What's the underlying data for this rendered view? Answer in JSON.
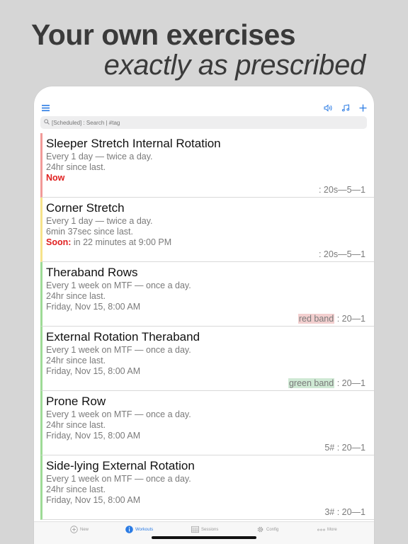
{
  "headline": "Your own exercises",
  "subline": "exactly as prescribed",
  "search": {
    "placeholder": "[Scheduled] : Search | #tag"
  },
  "colors": {
    "accent": "#2a7be4",
    "red": "#e02020",
    "now_bar": "#f19a98",
    "soon_bar": "#f6e38a",
    "ok_bar": "#9edb96"
  },
  "toolbar": {
    "icons": [
      "menu-icon",
      "speaker-icon",
      "music-note-icon",
      "plus-icon"
    ]
  },
  "exercises": [
    {
      "title": "Sleeper Stretch Internal Rotation",
      "schedule": "Every 1 day  — twice a day.",
      "since": "24hr since last.",
      "status": "Now",
      "tag": "",
      "sets": ": 20s—5—1"
    },
    {
      "title": "Corner Stretch",
      "schedule": "Every 1 day  — twice a day.",
      "since": "6min 37sec since last.",
      "soon_label": "Soon:",
      "soon_text": " in 22 minutes at 9:00 PM",
      "tag": "",
      "sets": ": 20s—5—1"
    },
    {
      "title": "Theraband Rows",
      "schedule": "Every 1 week on MTF — once a day.",
      "since": "24hr since last.",
      "next": "Friday, Nov 15, 8:00 AM",
      "tag": "red band",
      "sets": " : 20—1"
    },
    {
      "title": "External Rotation Theraband",
      "schedule": "Every 1 week on MTF — once a day.",
      "since": "24hr since last.",
      "next": "Friday, Nov 15, 8:00 AM",
      "tag": "green band",
      "sets": " : 20—1"
    },
    {
      "title": "Prone Row",
      "schedule": "Every 1 week on MTF — once a day.",
      "since": "24hr since last.",
      "next": "Friday, Nov 15, 8:00 AM",
      "tag": "",
      "sets": "5# : 20—1"
    },
    {
      "title": "Side-lying External Rotation",
      "schedule": "Every 1 week on MTF — once a day.",
      "since": "24hr since last.",
      "next": "Friday, Nov 15, 8:00 AM",
      "tag": "",
      "sets": "3# : 20—1"
    }
  ],
  "tabs": [
    {
      "label": "New",
      "icon": "plus-circle-icon"
    },
    {
      "label": "Workouts",
      "icon": "info-circle-icon",
      "active": true
    },
    {
      "label": "Sessions",
      "icon": "calendar-icon"
    },
    {
      "label": "Config",
      "icon": "gear-icon"
    },
    {
      "label": "More",
      "icon": "ellipsis-icon"
    }
  ]
}
